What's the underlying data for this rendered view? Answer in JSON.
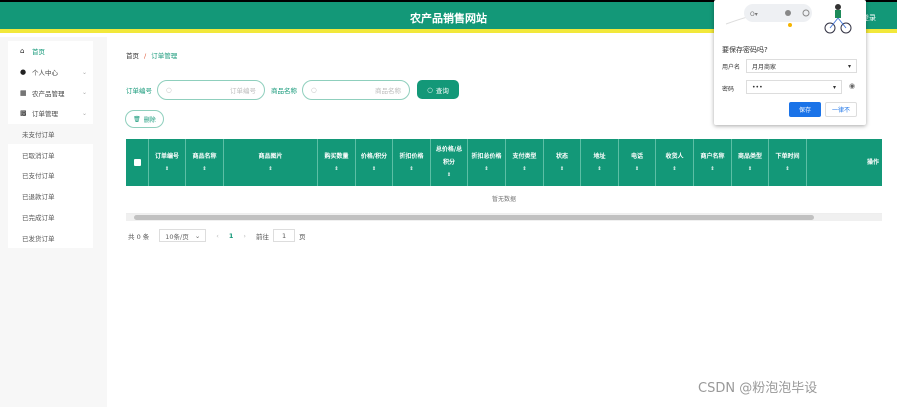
{
  "header": {
    "title": "农产品销售网站",
    "login": "登录"
  },
  "sidebar": {
    "items": [
      {
        "label": "首页",
        "icon": "home-icon"
      },
      {
        "label": "个人中心",
        "icon": "user-icon"
      },
      {
        "label": "农产品管理",
        "icon": "grid-icon"
      },
      {
        "label": "订单管理",
        "icon": "table-icon"
      }
    ],
    "subitems": [
      "未支付订单",
      "已取消订单",
      "已支付订单",
      "已退款订单",
      "已完成订单",
      "已发货订单"
    ]
  },
  "breadcrumb": {
    "home": "首页",
    "sep": "/",
    "current": "订单管理"
  },
  "search": {
    "order_label": "订单编号",
    "order_placeholder": "订单编号",
    "product_label": "商品名称",
    "product_placeholder": "商品名称",
    "query_button": "查询"
  },
  "actions": {
    "delete": "删除"
  },
  "table": {
    "columns": [
      "订单编号",
      "商品名称",
      "商品图片",
      "购买数量",
      "价格/积分",
      "折扣价格",
      "总价格/总积分",
      "折扣总价格",
      "支付类型",
      "状态",
      "地址",
      "电话",
      "收货人",
      "商户名称",
      "商品类型",
      "下单时间",
      "操作"
    ],
    "empty": "暂无数据"
  },
  "pagination": {
    "total": "共 0 条",
    "page_size": "10条/页",
    "current_page": "1",
    "goto_label": "前往",
    "goto_value": "1",
    "page_suffix": "页"
  },
  "password_popup": {
    "question": "要保存密码吗?",
    "username_label": "用户名",
    "username_value": "月月商家",
    "password_label": "密码",
    "password_value": "•••",
    "save": "保存",
    "never": "一律不"
  },
  "watermark": "CSDN @粉泡泡毕设",
  "colors": {
    "primary": "#139878",
    "accent": "#f2e83a",
    "popup_button": "#1a73e8"
  }
}
